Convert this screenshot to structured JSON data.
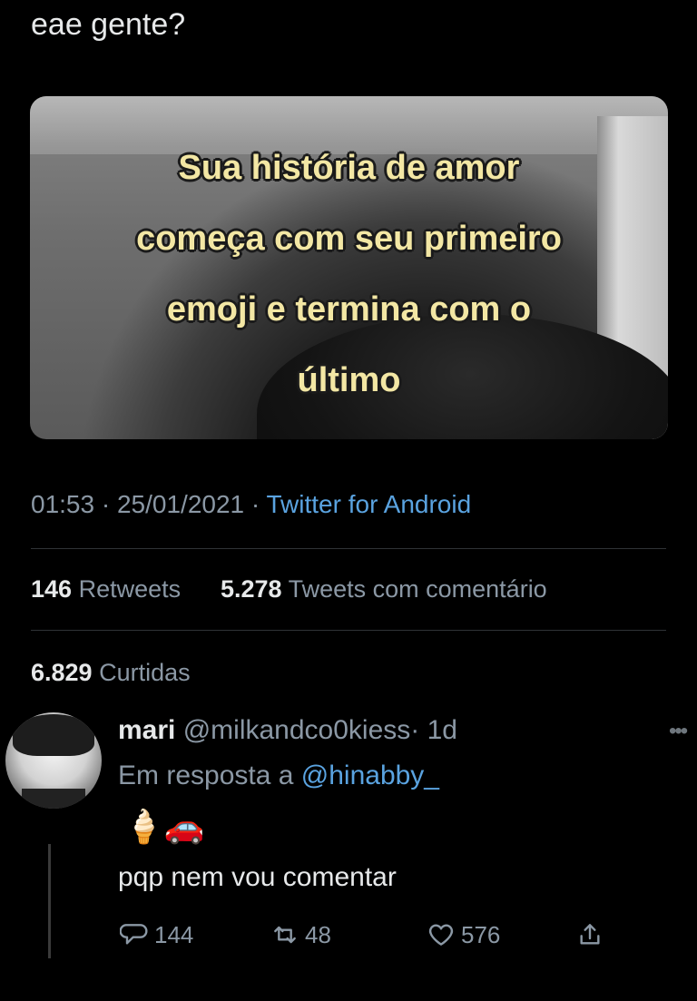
{
  "tweet": {
    "text": "eae gente?",
    "image_caption": [
      "Sua história de amor",
      "começa com seu primeiro",
      "emoji e termina com o",
      "último"
    ],
    "time": "01:53",
    "date": "25/01/2021",
    "separator": "·",
    "source": "Twitter for Android",
    "retweets_count": "146",
    "retweets_label": "Retweets",
    "quote_count": "5.278",
    "quote_label": "Tweets com comentário",
    "likes_count": "6.829",
    "likes_label": "Curtidas"
  },
  "reply": {
    "name": "mari",
    "handle": "@milkandco0kiess",
    "age": "· 1d",
    "in_reply_prefix": "Em resposta a",
    "in_reply_handle": "@hinabby_",
    "emojis": "🍦🚗",
    "text": "pqp nem vou comentar",
    "replies": "144",
    "retweets": "48",
    "likes": "576"
  },
  "colors": {
    "background": "#000000",
    "link": "#5aa3e0",
    "muted": "#8b98a5",
    "caption": "#f3e7a4"
  },
  "icons": [
    "more-icon",
    "reply-icon",
    "retweet-icon",
    "like-icon",
    "share-icon"
  ]
}
